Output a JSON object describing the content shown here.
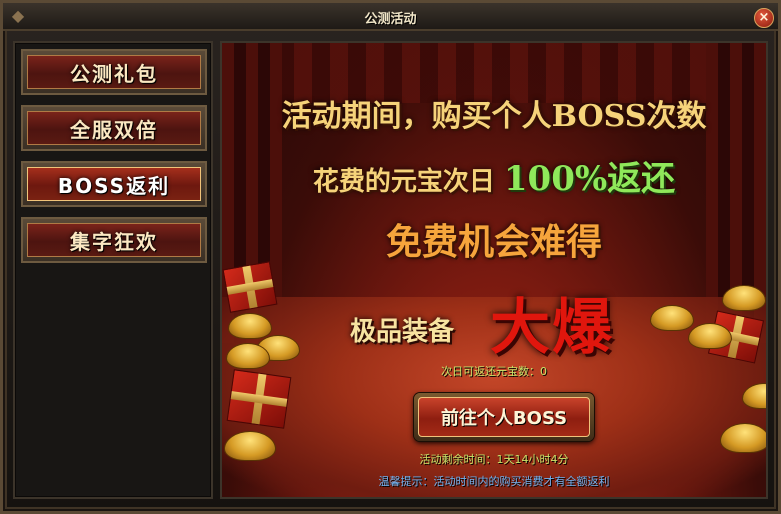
{
  "window": {
    "title": "公测活动",
    "close_label": "×"
  },
  "sidebar": {
    "items": [
      {
        "label": "公测礼包",
        "active": false
      },
      {
        "label": "全服双倍",
        "active": false
      },
      {
        "label": "BOSS返利",
        "active": true
      },
      {
        "label": "集字狂欢",
        "active": false
      }
    ]
  },
  "banner": {
    "line1": "活动期间，购买个人BOSS次数",
    "line2_prefix": "花费的元宝次日",
    "line2_highlight": "100%返还",
    "line3": "免费机会难得",
    "equip_label": "极品装备",
    "equip_highlight": "大爆"
  },
  "status": {
    "return_count": "次日可返还元宝数：0",
    "remaining_time": "活动剩余时间：1天14小时4分",
    "tip": "温馨提示：活动时间内的购买消费才有全额返利"
  },
  "actions": {
    "goto_boss": "前往个人BOSS"
  },
  "colors": {
    "accent_gold": "#f6d37a",
    "accent_green": "#8fe85a",
    "accent_red": "#e0160d",
    "tip_blue": "#6fb2f1",
    "info_green": "#c9e36a"
  }
}
